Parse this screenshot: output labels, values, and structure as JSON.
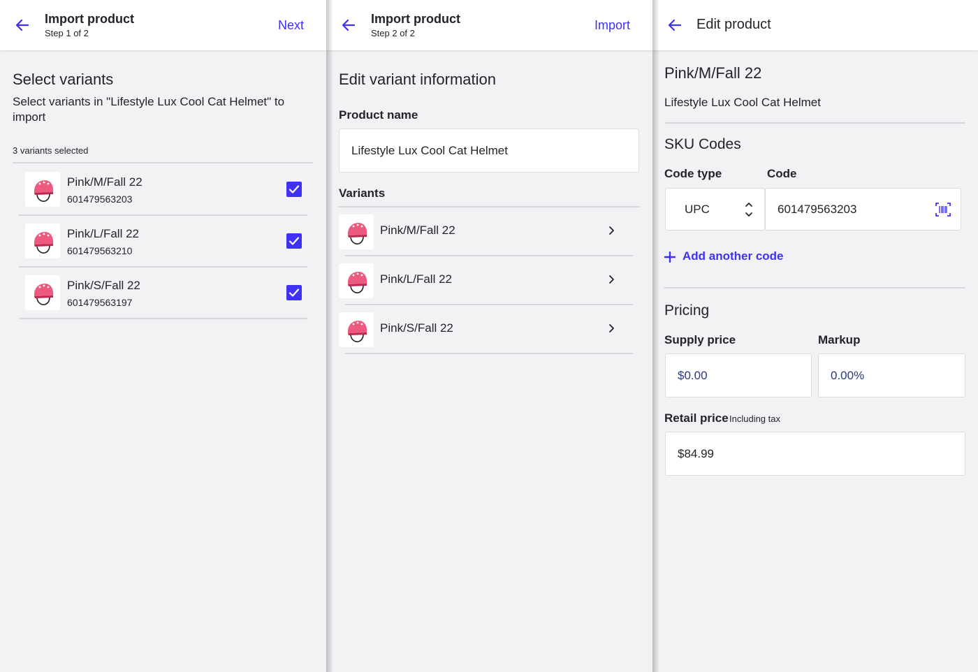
{
  "colors": {
    "accent": "#3f32f5",
    "background": "#f2f1f4",
    "surface": "#ffffff",
    "divider": "#d8d6dc"
  },
  "step1": {
    "header": {
      "title": "Import product",
      "subtitle": "Step 1 of 2",
      "action": "Next"
    },
    "heading": "Select variants",
    "description": "Select variants in \"Lifestyle Lux Cool Cat Helmet\" to import",
    "selected_count": "3 variants selected",
    "variants": [
      {
        "name": "Pink/M/Fall 22",
        "sku": "601479563203",
        "checked": true
      },
      {
        "name": "Pink/L/Fall 22",
        "sku": "601479563210",
        "checked": true
      },
      {
        "name": "Pink/S/Fall 22",
        "sku": "601479563197",
        "checked": true
      }
    ]
  },
  "step2": {
    "header": {
      "title": "Import product",
      "subtitle": "Step 2 of 2",
      "action": "Import"
    },
    "heading": "Edit variant information",
    "product_name_label": "Product name",
    "product_name_value": "Lifestyle Lux Cool Cat Helmet",
    "variants_label": "Variants",
    "variants": [
      {
        "name": "Pink/M/Fall 22"
      },
      {
        "name": "Pink/L/Fall 22"
      },
      {
        "name": "Pink/S/Fall 22"
      }
    ]
  },
  "edit": {
    "header": {
      "title": "Edit product"
    },
    "variant_name": "Pink/M/Fall 22",
    "product_name": "Lifestyle Lux Cool Cat Helmet",
    "sku_heading": "SKU Codes",
    "code_type_label": "Code type",
    "code_label": "Code",
    "code_type_value": "UPC",
    "code_value": "601479563203",
    "add_code": "Add another code",
    "pricing_heading": "Pricing",
    "supply_price_label": "Supply price",
    "markup_label": "Markup",
    "supply_price_value": "$0.00",
    "markup_value": "0.00%",
    "retail_price_label": "Retail price",
    "retail_price_note": "Including tax",
    "retail_price_value": "$84.99"
  },
  "icons": {
    "back": "arrow-left-icon",
    "checkbox": "checkbox-checked-icon",
    "chevron": "chevron-right-icon",
    "stepper": "stepper-arrows-icon",
    "barcode": "barcode-scan-icon",
    "plus": "plus-icon",
    "thumbnail": "pink-helmet-thumbnail"
  }
}
